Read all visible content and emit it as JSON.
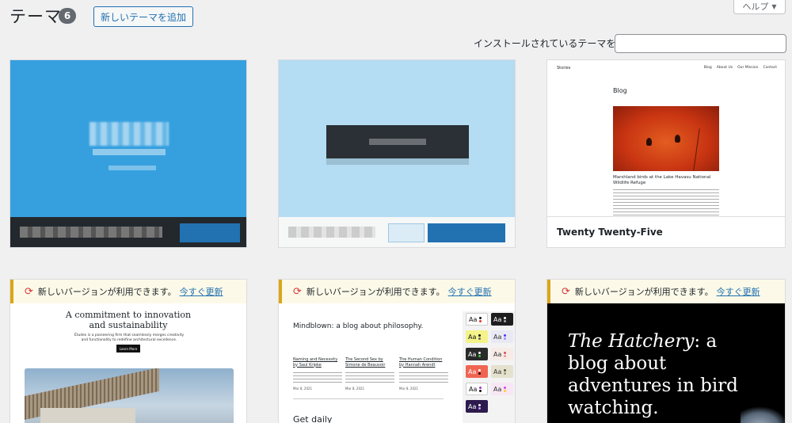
{
  "header": {
    "title": "テーマ",
    "count": "6",
    "add_button": "新しいテーマを追加",
    "help": "ヘルプ",
    "search_label": "インストールされているテーマを検索",
    "search_value": ""
  },
  "notice": {
    "text": "新しいバージョンが利用できます。",
    "link": "今すぐ更新"
  },
  "themes": [
    {
      "name": ""
    },
    {
      "name": ""
    },
    {
      "name": "Twenty Twenty-Five",
      "preview": {
        "site": "Stories",
        "nav": [
          "Blog",
          "About Us",
          "Our Mission",
          "Contact"
        ],
        "heading": "Blog",
        "caption": "Marshland birds at the Lake Havasu National Wildlife Refuge"
      }
    },
    {
      "preview": {
        "heading_line1": "A commitment to innovation",
        "heading_line2": "and sustainability",
        "sub": "Études is a pioneering firm that seamlessly merges creativity and functionality to redefine architectural excellence.",
        "button": "Learn More"
      }
    },
    {
      "preview": {
        "heading": "Mindblown: a blog about philosophy.",
        "posts": [
          {
            "title": "Naming and Necessity by Saul Kripke",
            "date": "Mar 8, 2021"
          },
          {
            "title": "The Second Sex by Simone de Beauvoir",
            "date": "Mar 8, 2021"
          },
          {
            "title": "The Human Condition by Hannah Arendt",
            "date": "Mar 8, 2021"
          }
        ],
        "footer": "Get daily",
        "swatch_label": "Aa"
      }
    },
    {
      "preview": {
        "heading_em": "The Hatchery",
        "heading_rest": ": a blog about adventures in bird watching."
      }
    }
  ],
  "colors": {
    "accent": "#2271b1",
    "notice_border": "#dba617",
    "update_icon": "#d63638"
  }
}
